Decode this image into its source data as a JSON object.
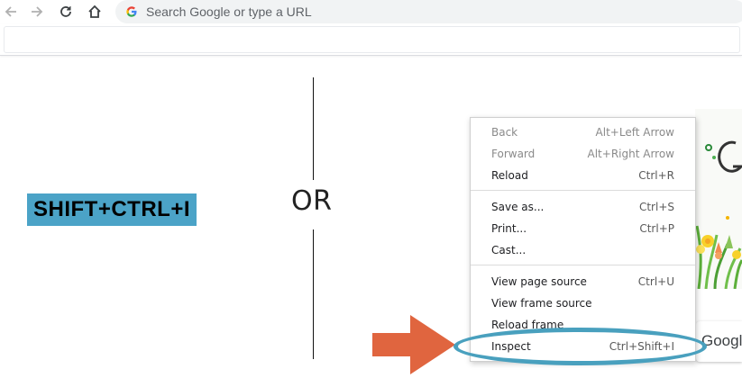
{
  "browser": {
    "omnibox_placeholder": "Search Google or type a URL",
    "icons": [
      "back-arrow-icon",
      "forward-arrow-icon",
      "reload-icon",
      "home-icon",
      "google-g-icon"
    ]
  },
  "content": {
    "shortcut": "SHIFT+CTRL+I",
    "or_text": "OR",
    "google_partial": "Google",
    "colors": {
      "label_bg": "#4ba3c7",
      "arrow": "#e0653f",
      "highlight_ring": "#49a0be"
    }
  },
  "context_menu": {
    "groups": [
      [
        {
          "label": "Back",
          "shortcut": "Alt+Left Arrow",
          "disabled": true
        },
        {
          "label": "Forward",
          "shortcut": "Alt+Right Arrow",
          "disabled": true
        },
        {
          "label": "Reload",
          "shortcut": "Ctrl+R",
          "disabled": false
        }
      ],
      [
        {
          "label": "Save as...",
          "shortcut": "Ctrl+S",
          "disabled": false
        },
        {
          "label": "Print...",
          "shortcut": "Ctrl+P",
          "disabled": false
        },
        {
          "label": "Cast...",
          "shortcut": "",
          "disabled": false
        }
      ],
      [
        {
          "label": "View page source",
          "shortcut": "Ctrl+U",
          "disabled": false
        },
        {
          "label": "View frame source",
          "shortcut": "",
          "disabled": false
        },
        {
          "label": "Reload frame",
          "shortcut": "",
          "disabled": false
        },
        {
          "label": "Inspect",
          "shortcut": "Ctrl+Shift+I",
          "disabled": false
        }
      ]
    ]
  }
}
